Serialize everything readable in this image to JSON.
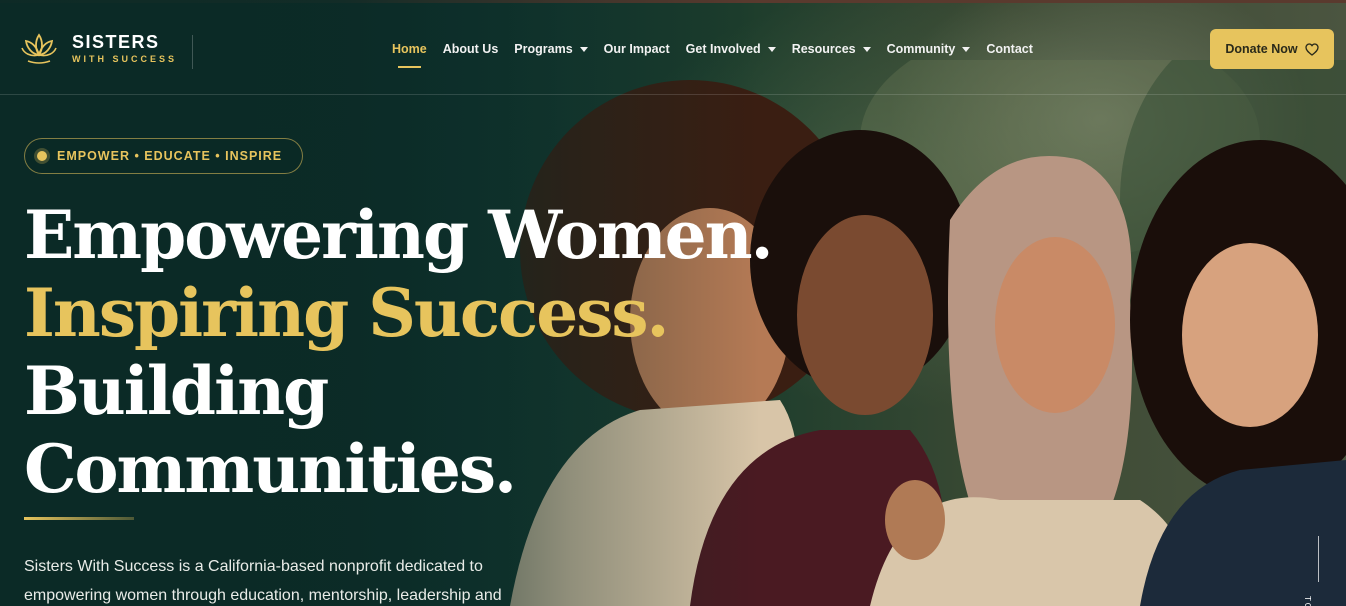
{
  "brand": {
    "name": "SISTERS",
    "tagline": "WITH SUCCESS",
    "logo_icon": "lotus-icon",
    "accent_color": "#e7c45d",
    "background_color": "#0b2a26"
  },
  "nav": {
    "items": [
      {
        "label": "Home",
        "active": true,
        "has_dropdown": false
      },
      {
        "label": "About Us",
        "active": false,
        "has_dropdown": false
      },
      {
        "label": "Programs",
        "active": false,
        "has_dropdown": true
      },
      {
        "label": "Our Impact",
        "active": false,
        "has_dropdown": false
      },
      {
        "label": "Get Involved",
        "active": false,
        "has_dropdown": true
      },
      {
        "label": "Resources",
        "active": false,
        "has_dropdown": true
      },
      {
        "label": "Community",
        "active": false,
        "has_dropdown": true
      },
      {
        "label": "Contact",
        "active": false,
        "has_dropdown": false
      }
    ]
  },
  "donate": {
    "label": "Donate Now",
    "icon": "heart-icon"
  },
  "hero": {
    "pill": "EMPOWER • EDUCATE • INSPIRE",
    "headline": {
      "line1": "Empowering Women.",
      "line2": "Inspiring Success.",
      "line3": "Building",
      "line4": "Communities."
    },
    "description": "Sisters With Success is a California-based nonprofit dedicated to empowering women through education, mentorship, leadership and",
    "scroll_hint": "TO"
  }
}
